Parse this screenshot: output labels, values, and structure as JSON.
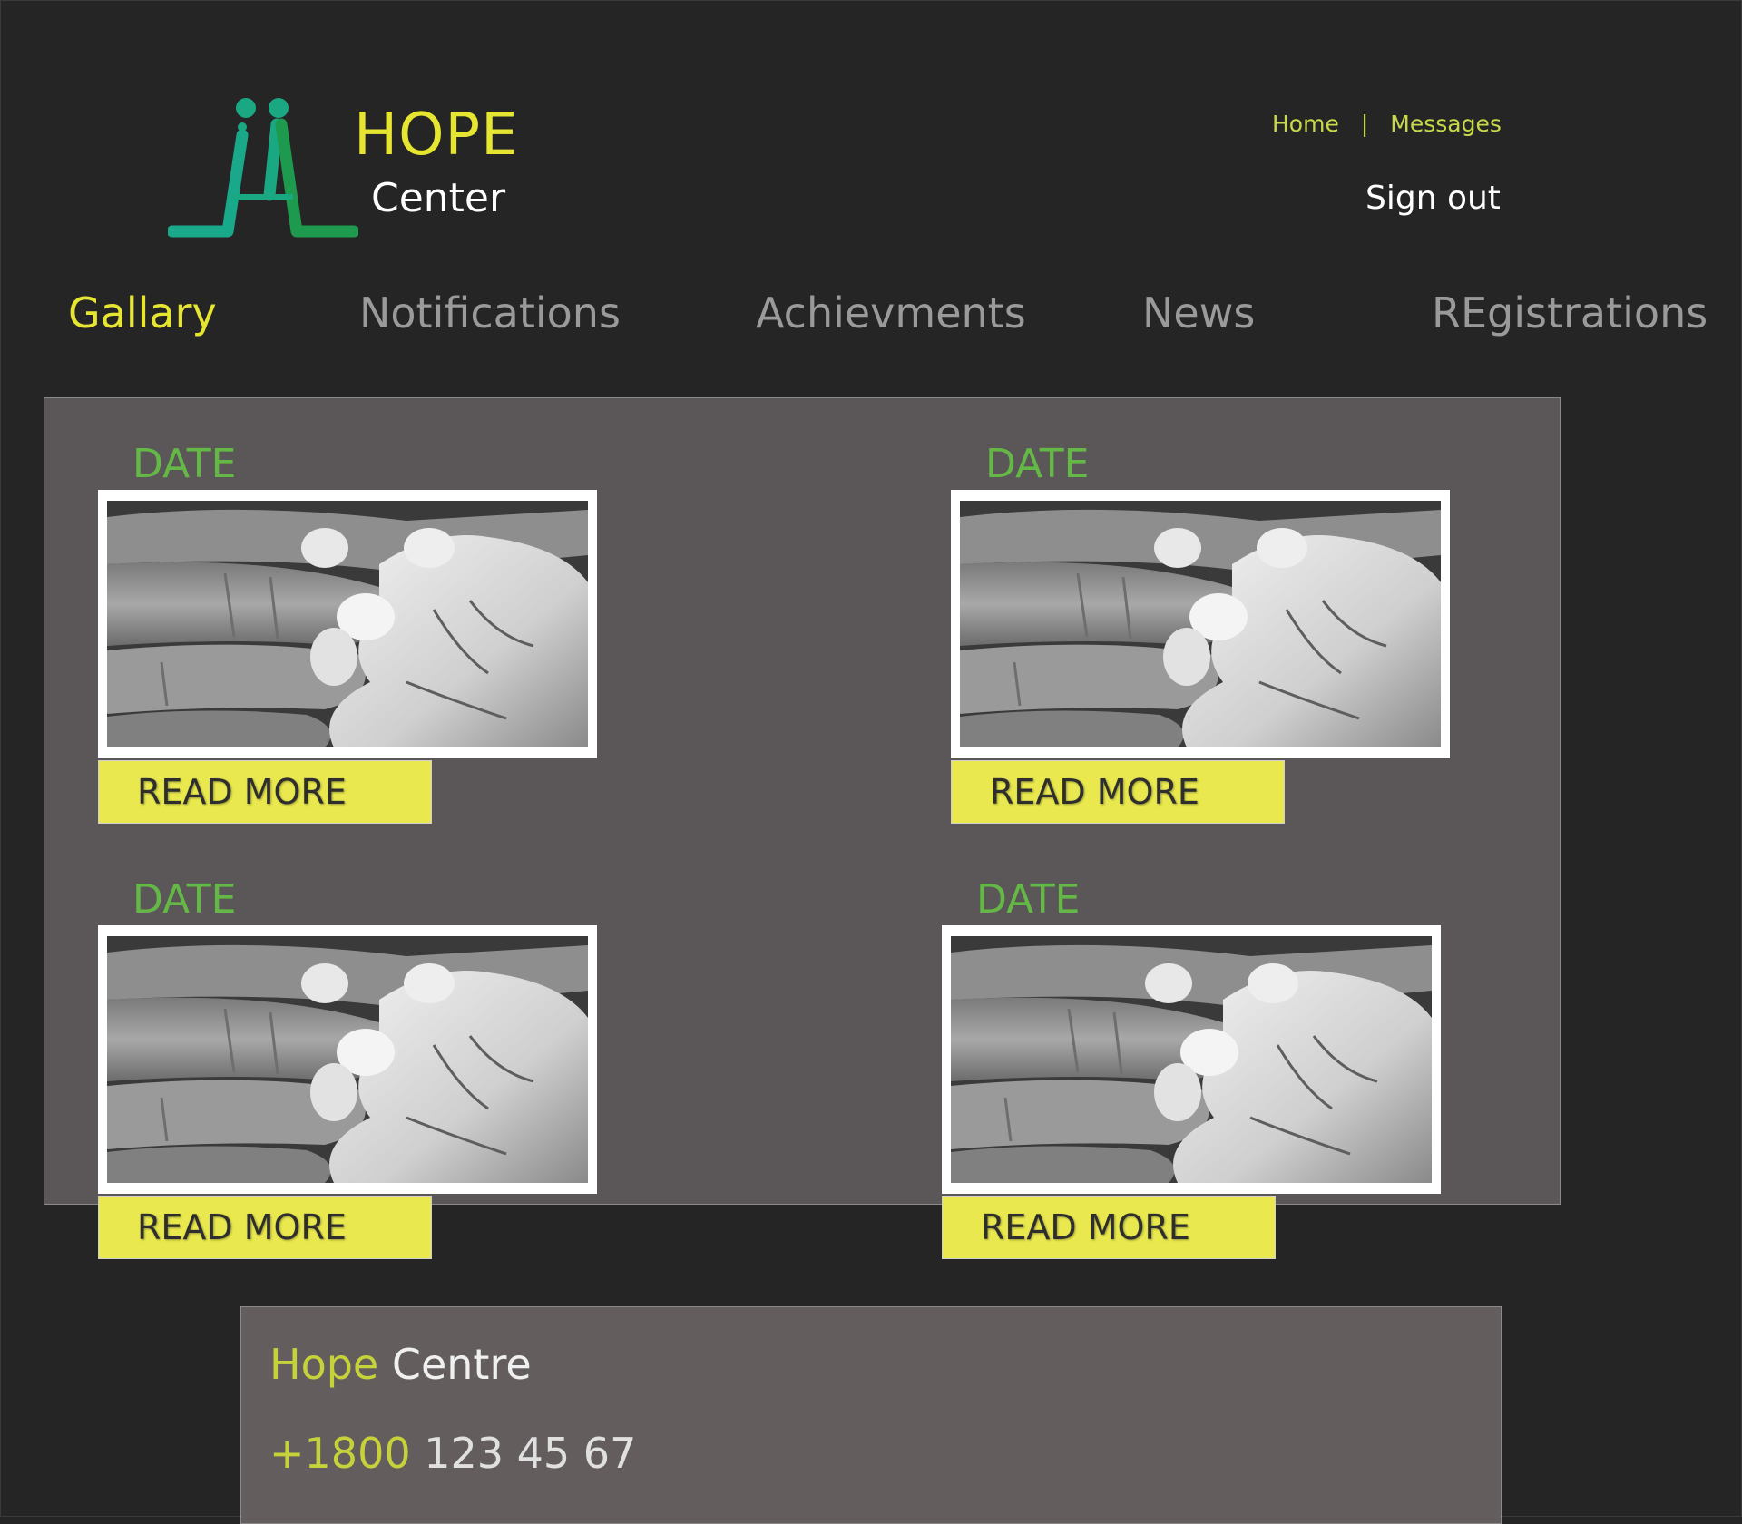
{
  "header": {
    "logo_title": "HOPE",
    "logo_subtitle": "Center",
    "links": [
      "Home",
      "Messages"
    ],
    "separator": "|",
    "signout_label": "Sign out"
  },
  "nav": {
    "items": [
      "Gallary",
      "Notifications",
      "Achievments",
      "News",
      "REgistrations"
    ],
    "active": "Gallary"
  },
  "gallery": {
    "cards": [
      {
        "date": "DATE",
        "button": "READ MORE"
      },
      {
        "date": "DATE",
        "button": "READ MORE"
      },
      {
        "date": "DATE",
        "button": "READ MORE"
      },
      {
        "date": "DATE",
        "button": "READ MORE"
      }
    ]
  },
  "footer": {
    "name_highlight": "Hope",
    "name_rest": "Centre",
    "phone_highlight": "+1800",
    "phone_rest": "123 45 67"
  },
  "colors": {
    "background": "#252525",
    "accent_yellow": "#e6e632",
    "date_green": "#64b946",
    "button_yellow": "#e9e84e",
    "panel": "#5b5758",
    "footer": "#645d5e"
  }
}
